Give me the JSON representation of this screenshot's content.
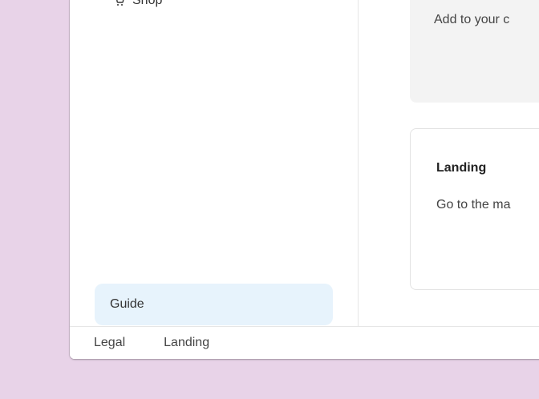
{
  "theme": {
    "background": "#E8D3E8",
    "window_bg": "#FFFFFF",
    "guide_bg": "#E7F3FC",
    "card_gray_bg": "#F3F3F3"
  },
  "sidebar": {
    "top_item": {
      "label": "Shop",
      "icon": "cart-icon"
    },
    "guide_label": "Guide"
  },
  "main": {
    "card_gray": {
      "text": "Add to your c"
    },
    "card": {
      "title": "Landing",
      "text": "Go to the ma"
    }
  },
  "footer": {
    "links": [
      "Legal",
      "Landing"
    ]
  }
}
